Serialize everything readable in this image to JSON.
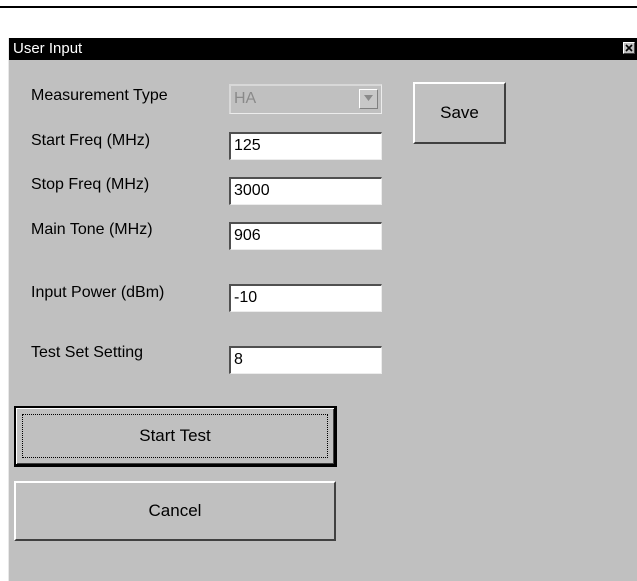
{
  "dialog": {
    "title": "User Input",
    "close_icon": "close-icon"
  },
  "form": {
    "measurement_type_label": "Measurement Type",
    "measurement_type_value": "HA",
    "start_freq_label": "Start Freq (MHz)",
    "start_freq_value": "125",
    "stop_freq_label": "Stop Freq (MHz)",
    "stop_freq_value": "3000",
    "main_tone_label": "Main Tone (MHz)",
    "main_tone_value": "906",
    "input_power_label": "Input Power (dBm)",
    "input_power_value": "-10",
    "test_set_label": "Test Set Setting",
    "test_set_value": "8"
  },
  "buttons": {
    "save_label": "Save",
    "start_test_label": "Start Test",
    "cancel_label": "Cancel"
  },
  "colors": {
    "dialog_background": "#c0c0c0",
    "titlebar_background": "#000000",
    "titlebar_text": "#ffffff",
    "disabled_text": "#8a8a8a"
  }
}
